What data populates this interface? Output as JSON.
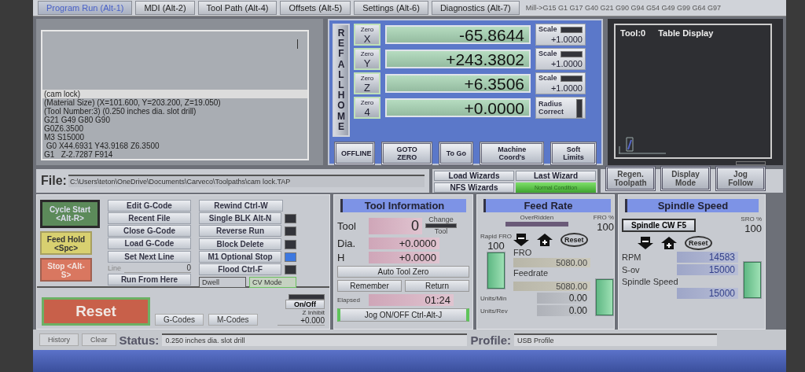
{
  "tabs": [
    {
      "label": "Program Run (Alt-1)",
      "selected": true
    },
    {
      "label": "MDI (Alt-2)",
      "selected": false
    },
    {
      "label": "Tool Path (Alt-4)",
      "selected": false
    },
    {
      "label": "Offsets (Alt-5)",
      "selected": false
    },
    {
      "label": "Settings (Alt-6)",
      "selected": false
    },
    {
      "label": "Diagnostics (Alt-7)",
      "selected": false
    }
  ],
  "modal_line": "Mill->G15  G1 G17 G40 G21 G90 G94 G54 G49 G99 G64 G97",
  "gcode": {
    "lines": [
      {
        "text": "(cam lock)",
        "selected": true
      },
      {
        "text": "(Material Size) (X=101.600, Y=203.200, Z=19.050)",
        "selected": false
      },
      {
        "text": "(Tool Number:3) (0.250 inches dia. slot drill)",
        "selected": false
      },
      {
        "text": "G21 G49 G80 G90",
        "selected": false
      },
      {
        "text": "G0Z6.3500",
        "selected": false
      },
      {
        "text": "M3 S15000",
        "selected": false
      },
      {
        "text": " G0 X44.6931 Y43.9168 Z6.3500",
        "selected": false
      },
      {
        "text": "G1   Z-2.7287 F914",
        "selected": false
      }
    ]
  },
  "dro": {
    "ref_all_home": "REF ALL HOME",
    "axes": [
      {
        "zero_label": "Zero",
        "axis": "X",
        "value": "-65.8644",
        "side": {
          "kind": "scale",
          "label": "Scale",
          "value": "+1.0000",
          "on": false
        }
      },
      {
        "zero_label": "Zero",
        "axis": "Y",
        "value": "+243.3802",
        "side": {
          "kind": "scale",
          "label": "Scale",
          "value": "+1.0000",
          "on": false
        }
      },
      {
        "zero_label": "Zero",
        "axis": "Z",
        "value": "+6.3506",
        "side": {
          "kind": "scale",
          "label": "Scale",
          "value": "+1.0000",
          "on": false
        }
      },
      {
        "zero_label": "Zero",
        "axis": "4",
        "value": "+0.0000",
        "side": {
          "kind": "radius",
          "label": "Radius Correct",
          "on": false
        }
      }
    ],
    "buttons": [
      "OFFLINE",
      "GOTO ZERO",
      "To Go",
      "Machine Coord's",
      "Soft Limits"
    ]
  },
  "toolpath": {
    "tool": "Tool:0",
    "title": "Table Display"
  },
  "file": {
    "label": "File:",
    "path": "C:\\Users\\teton\\OneDrive\\Documents\\Carveco\\Toolpaths\\cam lock.TAP"
  },
  "wizards": {
    "buttons": [
      "Load Wizards",
      "Last Wizard",
      "NFS Wizards"
    ],
    "condition": "Normal Condition"
  },
  "display_buttons": [
    "Regen. Toolpath",
    "Display Mode",
    "Jog Follow"
  ],
  "display_led_on": false,
  "control": {
    "cycle_start": "Cycle Start <Alt-R>",
    "feed_hold": "Feed Hold <Spc>",
    "stop": "Stop <Alt-S>",
    "file_buttons": [
      "Edit G-Code",
      "Recent File",
      "Close G-Code",
      "Load G-Code"
    ],
    "set_next_line": "Set Next Line",
    "line_label": "Line",
    "line_value": "0",
    "run_from_here": "Run From Here",
    "toggles": [
      {
        "label": "Rewind Ctrl-W",
        "kind": "button"
      },
      {
        "label": "Single BLK Alt-N",
        "kind": "toggle",
        "on": false
      },
      {
        "label": "Reverse Run",
        "kind": "toggle",
        "on": false
      },
      {
        "label": "Block Delete",
        "kind": "toggle",
        "on": false
      },
      {
        "label": "M1 Optional Stop",
        "kind": "toggle",
        "on": true
      },
      {
        "label": "Flood Ctrl-F",
        "kind": "toggle",
        "on": false
      }
    ],
    "dwell": {
      "label": "Dwell",
      "on": false
    },
    "cv_mode": {
      "label": "CV Mode",
      "on": true
    },
    "reset": "Reset",
    "gcodes": "G-Codes",
    "mcodes": "M-Codes",
    "z_inhibit": {
      "button": "On/Off",
      "label": "Z Inhibit",
      "value": "+0.000",
      "on": false
    }
  },
  "tool_info": {
    "title": "Tool Information",
    "tool_label": "Tool",
    "tool": "0",
    "change_label": "Change",
    "change_sub": "Tool",
    "dia_label": "Dia.",
    "dia": "+0.0000",
    "h_label": "H",
    "h": "+0.0000",
    "auto_tool_zero": "Auto Tool Zero",
    "remember": "Remember",
    "return": "Return",
    "elapsed_label": "Elapsed",
    "elapsed": "01:24",
    "jog": {
      "label": "Jog ON/OFF Ctrl-Alt-J",
      "on": true
    }
  },
  "feed_rate": {
    "title": "Feed Rate",
    "overridden": "OverRidden",
    "overridden_on": false,
    "fro_pct_label": "FRO %",
    "fro_pct": "100",
    "rapid_label": "Rapid FRO",
    "rapid": "100",
    "rapid_slider": {
      "level": 1
    },
    "reset": "Reset",
    "fro_label": "FRO",
    "fro": "5080.00",
    "feedrate_label": "Feedrate",
    "feedrate": "5080.00",
    "feed_slider": {
      "level": 1
    },
    "units_min_label": "Units/Min",
    "units_min": "0.00",
    "units_rev_label": "Units/Rev",
    "units_rev": "0.00"
  },
  "spindle": {
    "title": "Spindle Speed",
    "cw_button": "Spindle CW F5",
    "sro_label": "SRO %",
    "sro": "100",
    "reset": "Reset",
    "rpm_label": "RPM",
    "rpm": "14583",
    "sov_label": "S-ov",
    "sov": "15000",
    "speed_label": "Spindle Speed",
    "speed": "15000",
    "slider": {
      "level": 1
    }
  },
  "status": {
    "history": "History",
    "clear": "Clear",
    "label": "Status:",
    "text": "0.250 inches dia. slot drill",
    "profile_label": "Profile:",
    "profile": "USB Profile"
  }
}
